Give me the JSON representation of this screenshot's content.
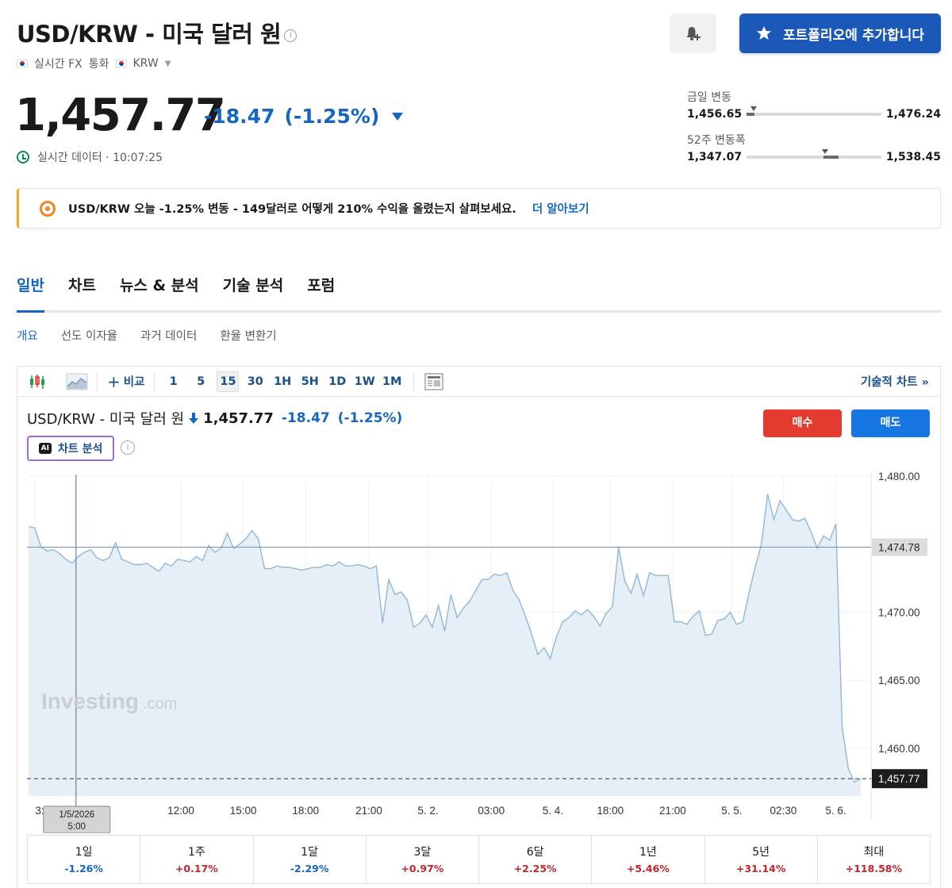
{
  "header": {
    "title": "USD/KRW - 미국 달러 원",
    "info_icon": "i",
    "realtime_label": "실시간 FX",
    "currency_label": "통화",
    "currency_code": "KRW",
    "bell_button_icon": "bell-plus-icon",
    "portfolio_button_label": "포트폴리오에 추가합니다"
  },
  "quote": {
    "price": "1,457.77",
    "change": "-18.47",
    "change_pct": "(-1.25%)",
    "time_label": "실시간 데이터 · 10:07:25"
  },
  "ranges": {
    "day": {
      "label": "금일 변동",
      "low": "1,456.65",
      "high": "1,476.24",
      "marker_fraction": 0.05,
      "fill_from": 0.0,
      "fill_to": 0.06
    },
    "week52": {
      "label": "52주 변동폭",
      "low": "1,347.07",
      "high": "1,538.45",
      "marker_fraction": 0.58,
      "fill_from": 0.57,
      "fill_to": 0.68
    }
  },
  "promo": {
    "text": "USD/KRW 오늘 -1.25% 변동 - 149달러로 어떻게 210% 수익을 올렸는지 살펴보세요.",
    "link": "더 알아보기",
    "accent_color": "#f5a623"
  },
  "tabs": [
    "일반",
    "차트",
    "뉴스 & 분석",
    "기술 분석",
    "포럼"
  ],
  "active_tab": "일반",
  "subtabs": [
    "개요",
    "선도 이자율",
    "과거 데이터",
    "환율 변환기"
  ],
  "toolbar": {
    "compare_label": "비교",
    "intervals": [
      "1",
      "5",
      "15",
      "30",
      "1H",
      "5H",
      "1D",
      "1W",
      "1M"
    ],
    "active_interval": "15",
    "technical_chart_label": "기술적 차트 »"
  },
  "chart_header": {
    "title": "USD/KRW - 미국 달러 원",
    "last_price": "1,457.77",
    "change": "-18.47",
    "change_pct": "(-1.25%)",
    "ai_badge": "AI",
    "ai_label": "차트 분석",
    "buy_label": "매수",
    "sell_label": "매도",
    "watermark_main": "Investing",
    "watermark_suffix": ".com"
  },
  "chart_data": {
    "type": "area",
    "ylim": [
      1456.5,
      1480.0
    ],
    "y_ticks": [
      "1,480.00",
      "1,470.00",
      "1,465.00",
      "1,460.00"
    ],
    "y_tick_values": [
      1480,
      1470,
      1465,
      1460
    ],
    "reference_line": {
      "value": 1474.78,
      "label": "1,474.78"
    },
    "last_line": {
      "value": 1457.77,
      "label": "1,457.77"
    },
    "x_tick_labels": [
      "3:0",
      "12:00",
      "15:00",
      "18:00",
      "21:00",
      "5. 2.",
      "03:00",
      "5. 4.",
      "18:00",
      "21:00",
      "5. 5.",
      "02:30",
      "5. 6."
    ],
    "x_tick_positions": [
      0.008,
      0.183,
      0.258,
      0.333,
      0.409,
      0.48,
      0.556,
      0.63,
      0.699,
      0.774,
      0.845,
      0.907,
      0.97
    ],
    "crosshair": {
      "position": 0.056,
      "date": "1/5/2026",
      "time": "5:00"
    },
    "line_color": "#8fb8d8",
    "fill_color": "#e6eef6",
    "series": [
      {
        "values": [
          1476.3,
          1476.2,
          1474.8,
          1474.5,
          1474.6,
          1474.3,
          1473.9,
          1473.6,
          1474.1,
          1474.4,
          1474.6,
          1474.0,
          1473.8,
          1474.0,
          1475.1,
          1473.9,
          1473.7,
          1473.5,
          1473.5,
          1473.6,
          1473.3,
          1473.0,
          1473.6,
          1473.4,
          1473.9,
          1473.8,
          1473.7,
          1474.1,
          1473.8,
          1474.9,
          1474.4,
          1474.7,
          1475.8,
          1474.7,
          1475.0,
          1475.4,
          1476.0,
          1475.4,
          1473.2,
          1473.2,
          1473.4,
          1473.3,
          1473.3,
          1473.2,
          1473.1,
          1473.2,
          1473.3,
          1473.3,
          1473.5,
          1473.4,
          1473.7,
          1473.4,
          1473.4,
          1473.5,
          1473.4,
          1473.2,
          1473.4,
          1469.2,
          1472.4,
          1471.3,
          1471.5,
          1470.9,
          1468.9,
          1469.2,
          1469.8,
          1468.9,
          1470.5,
          1468.6,
          1471.3,
          1469.6,
          1470.3,
          1470.8,
          1471.6,
          1472.4,
          1472.4,
          1472.8,
          1472.7,
          1472.9,
          1471.6,
          1470.9,
          1469.7,
          1468.4,
          1466.9,
          1467.4,
          1466.6,
          1468.2,
          1469.3,
          1469.6,
          1470.1,
          1469.8,
          1470.2,
          1469.7,
          1469.0,
          1469.9,
          1470.4,
          1474.8,
          1472.3,
          1471.4,
          1472.8,
          1471.2,
          1472.9,
          1472.7,
          1472.7,
          1472.7,
          1469.3,
          1469.3,
          1469.1,
          1469.7,
          1470.1,
          1468.3,
          1468.4,
          1469.4,
          1469.5,
          1470.0,
          1469.1,
          1469.3,
          1471.4,
          1473.3,
          1475.0,
          1478.7,
          1476.8,
          1478.2,
          1477.5,
          1476.8,
          1476.7,
          1476.9,
          1475.9,
          1474.7,
          1475.6,
          1475.3,
          1476.5,
          1461.6,
          1458.5,
          1457.5,
          1457.77
        ]
      }
    ]
  },
  "performance": [
    {
      "label": "1일",
      "value": "-1.26%",
      "sign": "neg"
    },
    {
      "label": "1주",
      "value": "+0.17%",
      "sign": "pos"
    },
    {
      "label": "1달",
      "value": "-2.29%",
      "sign": "neg"
    },
    {
      "label": "3달",
      "value": "+0.97%",
      "sign": "pos"
    },
    {
      "label": "6달",
      "value": "+2.25%",
      "sign": "pos"
    },
    {
      "label": "1년",
      "value": "+5.46%",
      "sign": "pos"
    },
    {
      "label": "5년",
      "value": "+31.14%",
      "sign": "pos"
    },
    {
      "label": "최대",
      "value": "+118.58%",
      "sign": "pos"
    }
  ]
}
